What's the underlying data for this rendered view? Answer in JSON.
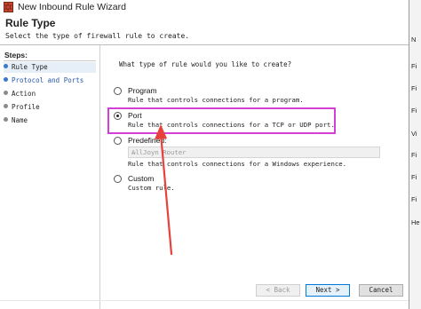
{
  "window": {
    "title": "New Inbound Rule Wizard"
  },
  "header": {
    "title": "Rule Type",
    "subtitle": "Select the type of firewall rule to create."
  },
  "steps": {
    "heading": "Steps:",
    "items": [
      {
        "label": "Rule Type",
        "state": "current"
      },
      {
        "label": "Protocol and Ports",
        "state": "link"
      },
      {
        "label": "Action",
        "state": "pending"
      },
      {
        "label": "Profile",
        "state": "pending"
      },
      {
        "label": "Name",
        "state": "pending"
      }
    ]
  },
  "main": {
    "question": "What type of rule would you like to create?",
    "options": [
      {
        "label": "Program",
        "desc": "Rule that controls connections for a program.",
        "selected": false
      },
      {
        "label": "Port",
        "desc": "Rule that controls connections for a TCP or UDP port.",
        "selected": true
      },
      {
        "label": "Predefined:",
        "desc": "Rule that controls connections for a Windows experience.",
        "selected": false
      },
      {
        "label": "Custom",
        "desc": "Custom rule.",
        "selected": false
      }
    ],
    "predefined_value": "AllJoyn Router"
  },
  "buttons": {
    "back": "< Back",
    "next": "Next >",
    "cancel": "Cancel"
  },
  "background_window": {
    "items": [
      "N",
      "Fi",
      "Fi",
      "Fi",
      "Vi",
      "Fi",
      "Fi",
      "Fi",
      "He"
    ]
  },
  "colors": {
    "highlight": "#d43fd8",
    "arrow": "#e8413c",
    "step_link": "#2457a8"
  },
  "icons": {
    "title": "firewall-icon",
    "dropdown": "chevron-down-icon"
  }
}
